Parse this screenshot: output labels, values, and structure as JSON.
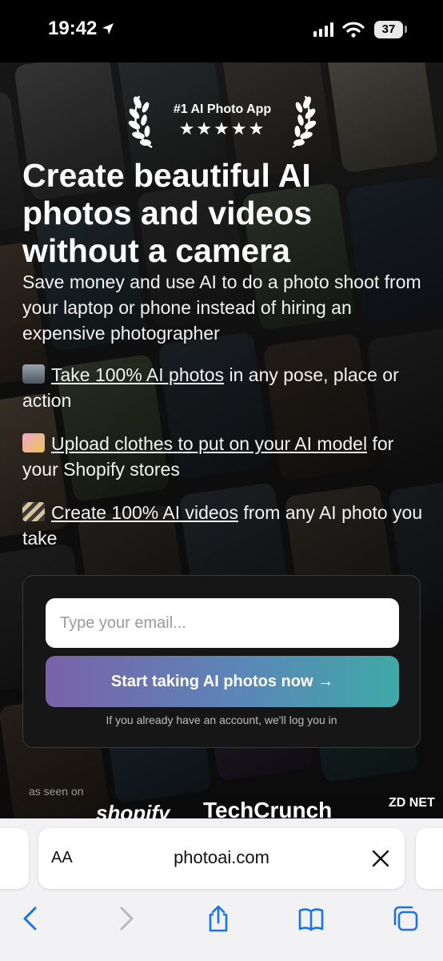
{
  "status_bar": {
    "time": "19:42",
    "battery": "37"
  },
  "badge": {
    "label": "#1 AI Photo App",
    "stars": "★★★★★",
    "rating": 5
  },
  "headline": "Create beautiful AI photos and videos without a camera",
  "subhead": "Save money and use AI to do a photo shoot from your laptop or phone instead of hiring an expensive photographer",
  "features": [
    {
      "icon": "camera-flash-emoji",
      "link": "Take 100% AI photos",
      "rest": " in any pose, place or action"
    },
    {
      "icon": "shopping-bags-emoji",
      "link": "Upload clothes to put on your AI model",
      "rest": " for your Shopify stores"
    },
    {
      "icon": "clapper-board-emoji",
      "link": "Create 100% AI videos",
      "rest": " from any AI photo you take"
    }
  ],
  "signup": {
    "email_placeholder": "Type your email...",
    "cta_label": "Start taking AI photos now →",
    "note": "If you already have an account, we'll log you in"
  },
  "press": {
    "label": "as seen on",
    "logos": [
      "shopify",
      "TechCrunch",
      "ZD NET"
    ]
  },
  "browser": {
    "aa": "AA",
    "url": "photoai.com"
  },
  "colors": {
    "cta_start": "#7a62a8",
    "cta_end": "#3fa9a6",
    "ios_blue": "#1a73e8"
  }
}
